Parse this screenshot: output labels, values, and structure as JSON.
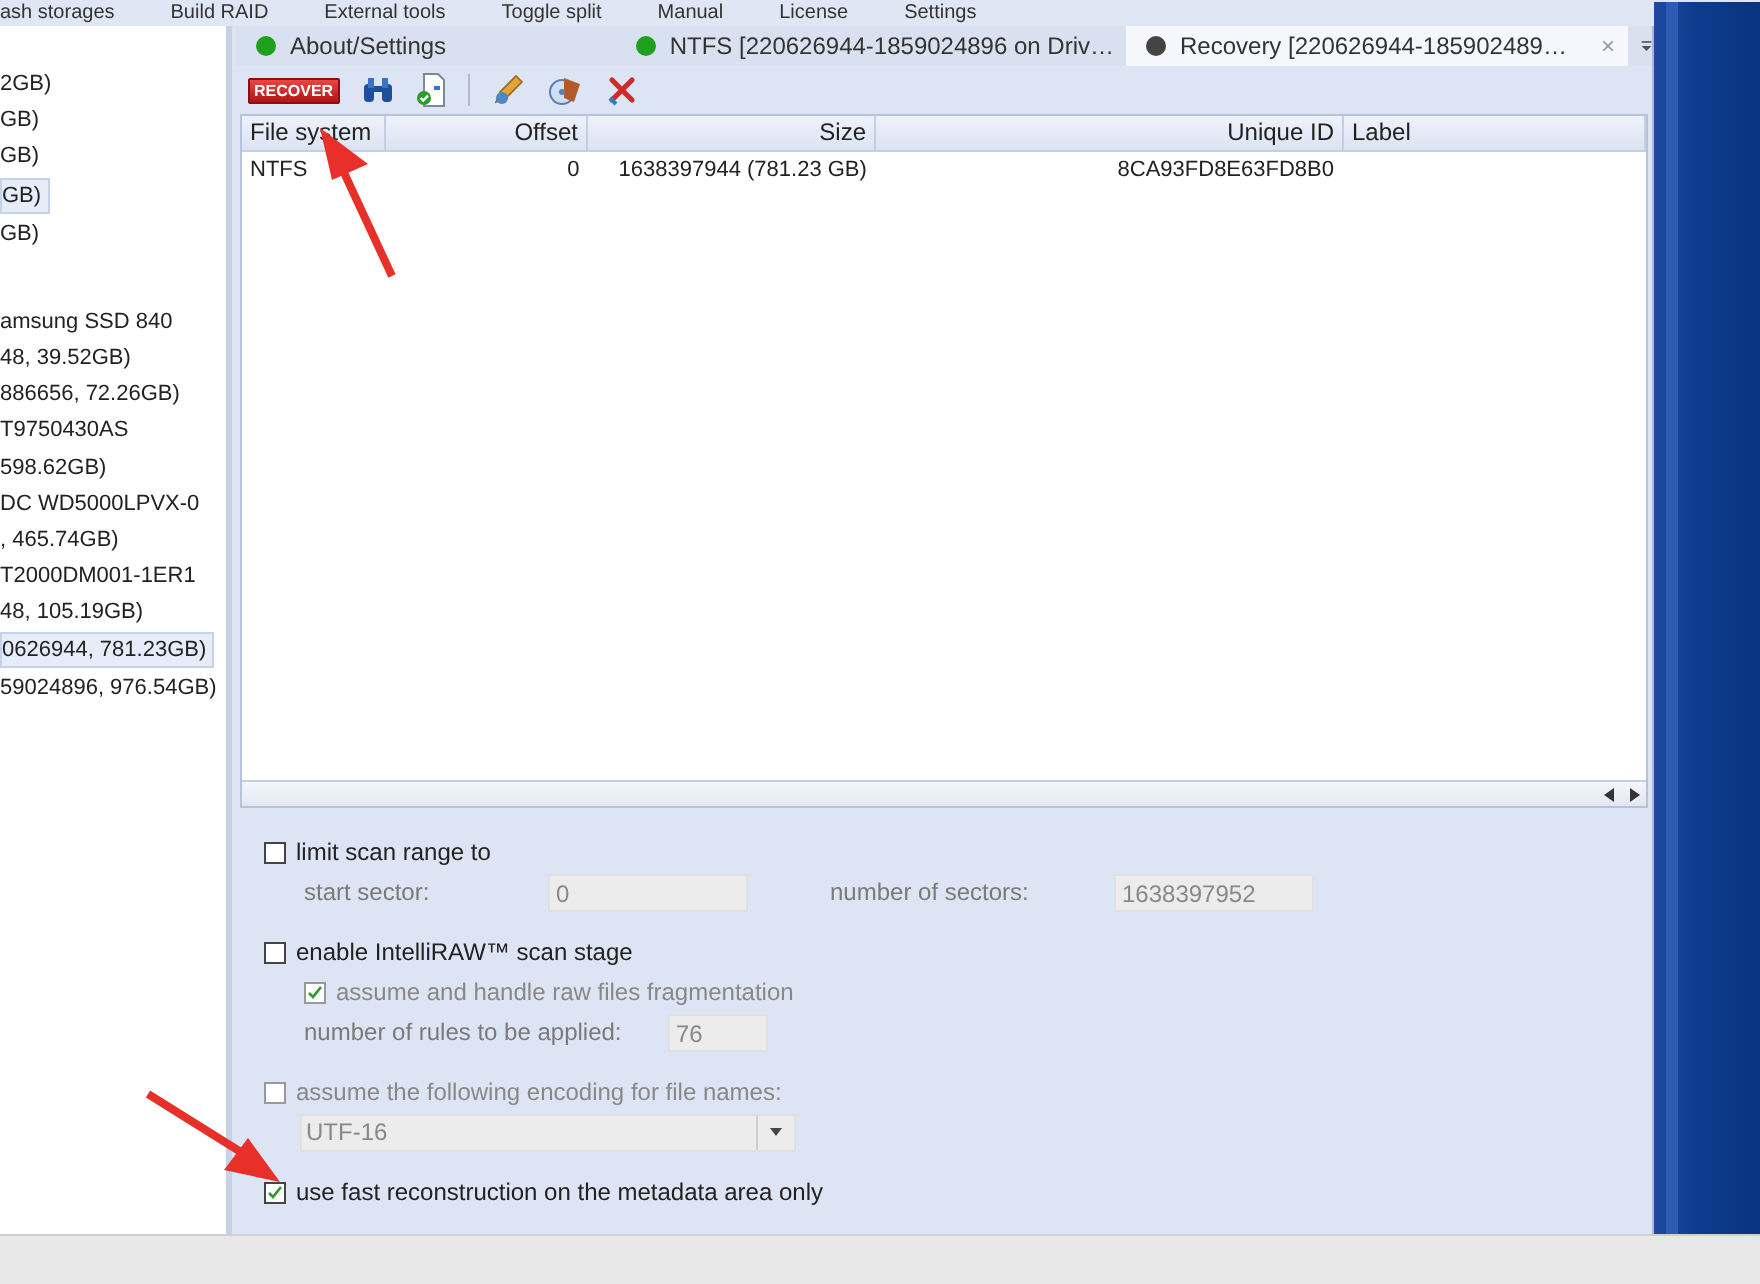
{
  "menu": [
    "ash storages",
    "Build RAID",
    "External tools",
    "Toggle split",
    "Manual",
    "License",
    "Settings"
  ],
  "sidebar": {
    "items": [
      {
        "label": "2GB)",
        "selected": false
      },
      {
        "label": "GB)",
        "selected": false
      },
      {
        "label": "GB)",
        "selected": false
      },
      {
        "label": "GB)",
        "selected": true
      },
      {
        "label": "GB)",
        "selected": false
      },
      {
        "label": "amsung SSD 840",
        "selected": false,
        "children": [
          {
            "label": "48, 39.52GB)",
            "selected": false
          },
          {
            "label": "886656, 72.26GB)",
            "selected": false
          }
        ]
      },
      {
        "label": "T9750430AS",
        "selected": false,
        "children": [
          {
            "label": "598.62GB)",
            "selected": false
          }
        ]
      },
      {
        "label": "DC WD5000LPVX-0",
        "selected": false,
        "children": [
          {
            "label": ", 465.74GB)",
            "selected": false
          }
        ]
      },
      {
        "label": "T2000DM001-1ER1",
        "selected": false,
        "children": [
          {
            "label": "48, 105.19GB)",
            "selected": false
          },
          {
            "label": "0626944, 781.23GB)",
            "selected": true
          },
          {
            "label": "59024896, 976.54GB)",
            "selected": false
          }
        ]
      }
    ]
  },
  "tabs": [
    {
      "label": "About/Settings",
      "color": "#1fa11f",
      "selected": false,
      "closable": false
    },
    {
      "label": "NTFS [220626944-1859024896 on Driv…",
      "color": "#1fa11f",
      "selected": false,
      "closable": false
    },
    {
      "label": "Recovery [220626944-185902489…",
      "color": "#444444",
      "selected": true,
      "closable": true,
      "close": "×"
    }
  ],
  "toolbar": {
    "recover": "RECOVER"
  },
  "table": {
    "columns": [
      "File system",
      "Offset",
      "Size",
      "Unique ID",
      "Label"
    ],
    "rows": [
      [
        "NTFS",
        "0",
        "1638397944 (781.23 GB)",
        "8CA93FD8E63FD8B0",
        ""
      ]
    ]
  },
  "options": [
    {
      "kind": "checkbox",
      "label": "limit scan range to",
      "checked": false,
      "disabled": false
    },
    {
      "kind": "fields",
      "fields": [
        {
          "label": "start sector:",
          "value": "0"
        },
        {
          "label": "number of sectors:",
          "value": "1638397952"
        }
      ]
    },
    {
      "kind": "checkbox",
      "label": "enable IntelliRAW™ scan stage",
      "checked": false,
      "disabled": false
    },
    {
      "kind": "subcheckbox",
      "label": "assume and handle raw files fragmentation",
      "checked": true,
      "disabled": true
    },
    {
      "kind": "fields",
      "fields": [
        {
          "label": "number of rules to be applied:",
          "value": "76"
        }
      ]
    },
    {
      "kind": "checkbox",
      "label": "assume the following encoding for file names:",
      "checked": false,
      "disabled": true
    },
    {
      "kind": "dropdown",
      "value": "UTF-16"
    },
    {
      "kind": "checkbox",
      "label": "use fast reconstruction on the metadata area only",
      "checked": true,
      "disabled": false
    }
  ]
}
